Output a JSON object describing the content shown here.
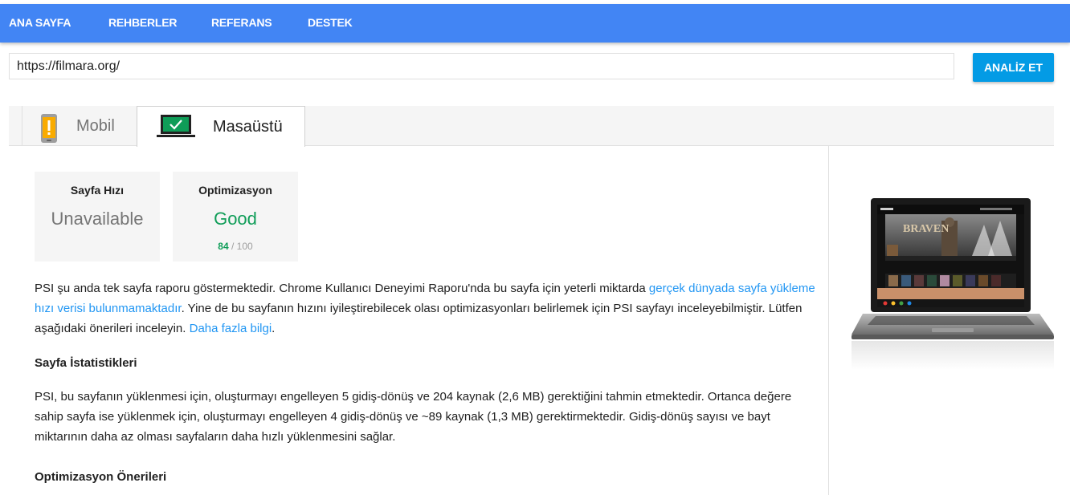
{
  "nav": {
    "items": [
      "ANA SAYFA",
      "REHBERLER",
      "REFERANS",
      "DESTEK"
    ]
  },
  "search": {
    "url_value": "https://filmara.org/",
    "analyze_label": "ANALİZ ET"
  },
  "tabs": {
    "mobile_label": "Mobil",
    "desktop_label": "Masaüstü",
    "active": "Masaüstü"
  },
  "scores": {
    "speed": {
      "title": "Sayfa Hızı",
      "value": "Unavailable"
    },
    "optimization": {
      "title": "Optimizasyon",
      "value": "Good",
      "score": "84",
      "max": " / 100"
    }
  },
  "intro": {
    "text_1": "PSI şu anda tek sayfa raporu göstermektedir. Chrome Kullanıcı Deneyimi Raporu'nda bu sayfa için yeterli miktarda ",
    "link_1": "gerçek dünyada sayfa yükleme hızı verisi bulunmamaktadır",
    "text_2": ". Yine de bu sayfanın hızını iyileştirebilecek olası optimizasyonları belirlemek için PSI sayfayı inceleyebilmiştir. Lütfen aşağıdaki önerileri inceleyin. ",
    "link_2": "Daha fazla bilgi",
    "text_3": "."
  },
  "stats": {
    "heading": "Sayfa İstatistikleri",
    "text": "PSI, bu sayfanın yüklenmesi için, oluşturmayı engelleyen 5 gidiş-dönüş ve 204 kaynak (2,6 MB) gerektiğini tahmin etmektedir. Ortanca değere sahip sayfa ise yüklenmek için, oluşturmayı engelleyen 4 gidiş-dönüş ve ~89 kaynak (1,3 MB) gerektirmektedir. Gidiş-dönüş sayısı ve bayt miktarının daha az olması sayfaların daha hızlı yüklenmesini sağlar."
  },
  "optimization_heading": "Optimizasyon Önerileri",
  "preview": {
    "movie_title": "BRAVEN"
  },
  "colors": {
    "nav_bg": "#4285f4",
    "button_bg": "#039be5",
    "good": "#0f9d58",
    "link": "#2196f3",
    "warning": "#f9ab00"
  },
  "icons": {
    "mobile_tab": "phone-warning-icon",
    "desktop_tab": "laptop-check-icon"
  }
}
